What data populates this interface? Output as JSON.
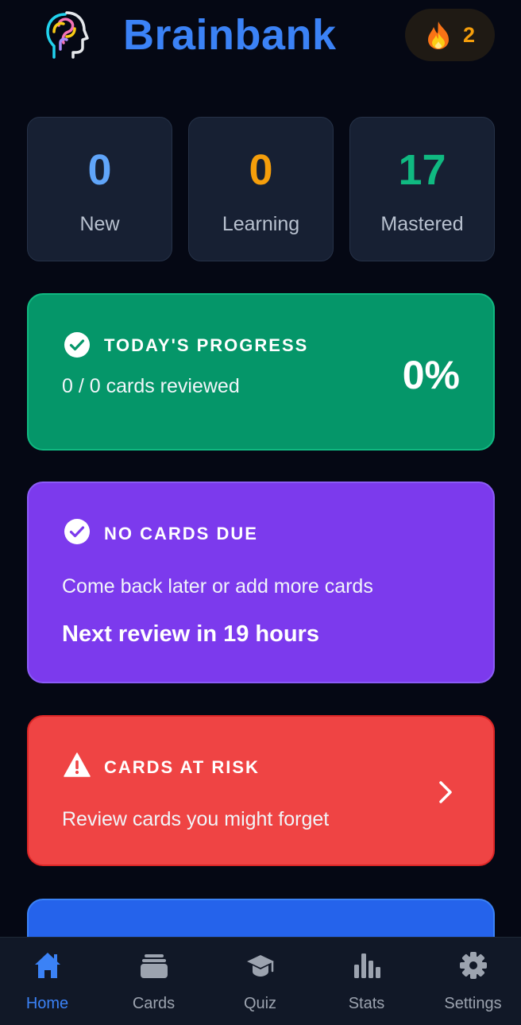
{
  "header": {
    "title": "Brainbank",
    "logo_icon": "brain-head-logo",
    "streak": {
      "icon": "flame-icon",
      "count": "2"
    }
  },
  "stats": [
    {
      "value": "0",
      "label": "New",
      "color": "#60a5fa"
    },
    {
      "value": "0",
      "label": "Learning",
      "color": "#f59e0b"
    },
    {
      "value": "17",
      "label": "Mastered",
      "color": "#10b981"
    }
  ],
  "progress": {
    "title": "TODAY'S PROGRESS",
    "subtitle": "0 / 0 cards reviewed",
    "percent": "0%",
    "icon": "check-circle-icon"
  },
  "due": {
    "title": "NO CARDS DUE",
    "subtitle": "Come back later or add more cards",
    "next": "Next review in 19 hours",
    "icon": "check-circle-icon"
  },
  "risk": {
    "title": "CARDS AT RISK",
    "subtitle": "Review cards you might forget",
    "icon": "warning-triangle-icon"
  },
  "nav": {
    "items": [
      {
        "label": "Home",
        "icon": "home-icon",
        "active": true
      },
      {
        "label": "Cards",
        "icon": "cards-icon"
      },
      {
        "label": "Quiz",
        "icon": "graduation-cap-icon"
      },
      {
        "label": "Stats",
        "icon": "bar-chart-icon"
      },
      {
        "label": "Settings",
        "icon": "gear-icon"
      }
    ]
  },
  "colors": {
    "accent": "#3b82f6",
    "progress_bg": "#059669",
    "due_bg": "#7c3aed",
    "risk_bg": "#ef4444"
  }
}
